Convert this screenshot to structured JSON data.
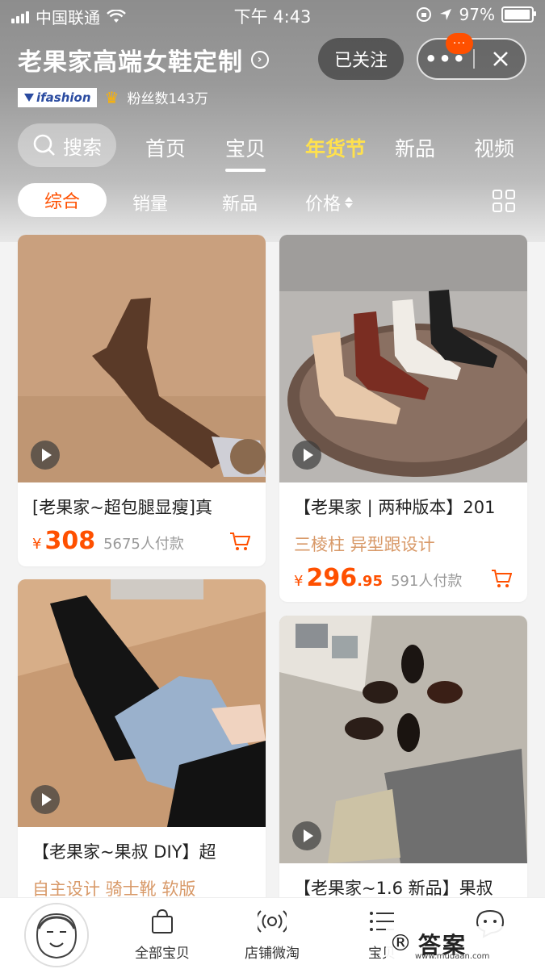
{
  "status_bar": {
    "carrier": "中国联通",
    "time": "下午 4:43",
    "battery": "97%",
    "battery_level": 0.97
  },
  "header": {
    "shop_name": "老果家高端女鞋定制",
    "follow_label": "已关注",
    "notification_badge": "···",
    "brand_badge": "ifashion",
    "fans_text": "粉丝数143万"
  },
  "nav": {
    "search_label": "搜索",
    "tabs": [
      {
        "label": "首页"
      },
      {
        "label": "宝贝"
      },
      {
        "label": "年货节"
      },
      {
        "label": "新品"
      },
      {
        "label": "视频"
      }
    ]
  },
  "sort": {
    "items": [
      {
        "label": "综合"
      },
      {
        "label": "销量"
      },
      {
        "label": "新品"
      },
      {
        "label": "价格"
      }
    ]
  },
  "products": [
    {
      "title": "[老果家~超包腿显瘦]真",
      "currency": "¥",
      "price": "308",
      "price_decimal": "",
      "sold": "5675人付款",
      "tags": ""
    },
    {
      "title": "【老果家 | 两种版本】201",
      "currency": "¥",
      "price": "296",
      "price_decimal": ".95",
      "sold": "591人付款",
      "tags": "三棱柱 异型跟设计"
    },
    {
      "title": "【老果家~果叔 DIY】超",
      "currency": "",
      "price": "",
      "price_decimal": "",
      "sold": "",
      "tags": "自主设计 骑士靴 软版"
    },
    {
      "title": "【老果家~1.6 新品】果叔",
      "currency": "",
      "price": "",
      "price_decimal": "",
      "sold": "",
      "tags": ""
    }
  ],
  "tabbar": {
    "items": [
      {
        "label": "全部宝贝",
        "icon": "shopping-bag-icon"
      },
      {
        "label": "店铺微淘",
        "icon": "broadcast-icon"
      },
      {
        "label": "宝贝",
        "icon": "list-icon"
      }
    ]
  },
  "watermark": {
    "text": "答案",
    "url": "www.mudaan.com"
  },
  "colors": {
    "accent": "#ff5000",
    "festival": "#ffe14d",
    "tag": "#d89968"
  }
}
